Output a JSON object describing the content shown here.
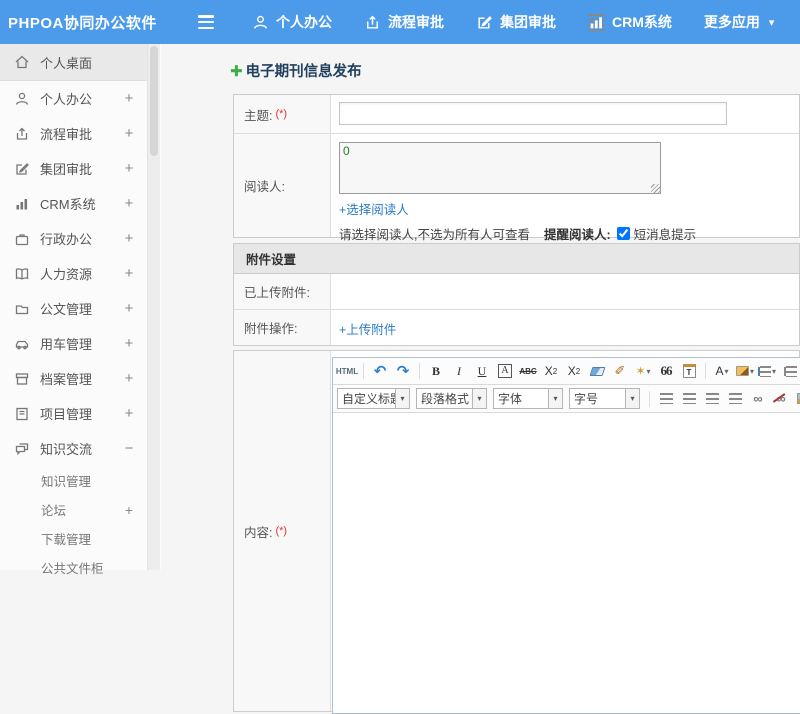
{
  "colors": {
    "header_blue": "#4b9bea",
    "link_blue": "#2b7cc7",
    "accent_green": "#3fae49",
    "required_red": "#e53333",
    "title_navy": "#20405e"
  },
  "header": {
    "brand": "PHPOA协同办公软件",
    "nav": [
      {
        "label": "个人办公",
        "icon": "person-icon"
      },
      {
        "label": "流程审批",
        "icon": "workflow-icon"
      },
      {
        "label": "集团审批",
        "icon": "edit-approve-icon"
      },
      {
        "label": "CRM系统",
        "icon": "bar-chart-icon"
      },
      {
        "label": "更多应用",
        "icon": "none",
        "caret": "▾"
      }
    ]
  },
  "sidebar": {
    "items": [
      {
        "label": "个人桌面",
        "icon": "home-icon",
        "sign": "",
        "active": true
      },
      {
        "label": "个人办公",
        "icon": "person-icon",
        "sign": "+"
      },
      {
        "label": "流程审批",
        "icon": "workflow-icon",
        "sign": "+"
      },
      {
        "label": "集团审批",
        "icon": "edit-approve-icon",
        "sign": "+"
      },
      {
        "label": "CRM系统",
        "icon": "bar-chart-icon",
        "sign": "+"
      },
      {
        "label": "行政办公",
        "icon": "briefcase-icon",
        "sign": "+"
      },
      {
        "label": "人力资源",
        "icon": "book-icon",
        "sign": "+"
      },
      {
        "label": "公文管理",
        "icon": "folder-doc-icon",
        "sign": "+"
      },
      {
        "label": "用车管理",
        "icon": "car-icon",
        "sign": "+"
      },
      {
        "label": "档案管理",
        "icon": "archive-icon",
        "sign": "+"
      },
      {
        "label": "项目管理",
        "icon": "notebook-icon",
        "sign": "+"
      },
      {
        "label": "知识交流",
        "icon": "chat-icon",
        "sign": "−"
      }
    ],
    "sub_items": [
      {
        "label": "知识管理",
        "sign": ""
      },
      {
        "label": "论坛",
        "sign": "+"
      },
      {
        "label": "下载管理",
        "sign": ""
      },
      {
        "label": "公共文件柜",
        "sign": ""
      }
    ]
  },
  "main": {
    "page_title": "电子期刊信息发布",
    "form": {
      "subject_label": "主题:",
      "required_mark": "(*)",
      "subject_value": "",
      "readers_label": "阅读人:",
      "readers_value": "0",
      "select_readers_link": "+选择阅读人",
      "readers_hint": "请选择阅读人,不选为所有人可查看",
      "remind_label": "提醒阅读人:",
      "sms_checkbox_label": "短消息提示",
      "sms_checked": true,
      "attachment_section_title": "附件设置",
      "uploaded_label": "已上传附件:",
      "uploaded_value": "",
      "attachment_action_label": "附件操作:",
      "upload_link": "+上传附件",
      "content_label": "内容:"
    },
    "editor": {
      "html_button": "HTML",
      "undo_glyph": "↶",
      "redo_glyph": "↷",
      "bold": "B",
      "italic": "I",
      "underline": "U",
      "font_border": "A",
      "strike": "ABC",
      "sup_base": "X",
      "sup_exp": "2",
      "sub_base": "X",
      "sub_exp": "2",
      "brush_glyph": "✐",
      "wand_glyph": "✶",
      "quote": "66",
      "paste_letter": "T",
      "font_color_letter": "A",
      "caret": "▾",
      "link_glyph": "∞",
      "unlink_glyph": "∞",
      "combos": [
        "自定义标题",
        "段落格式",
        "字体",
        "字号"
      ],
      "body_text": ""
    }
  }
}
